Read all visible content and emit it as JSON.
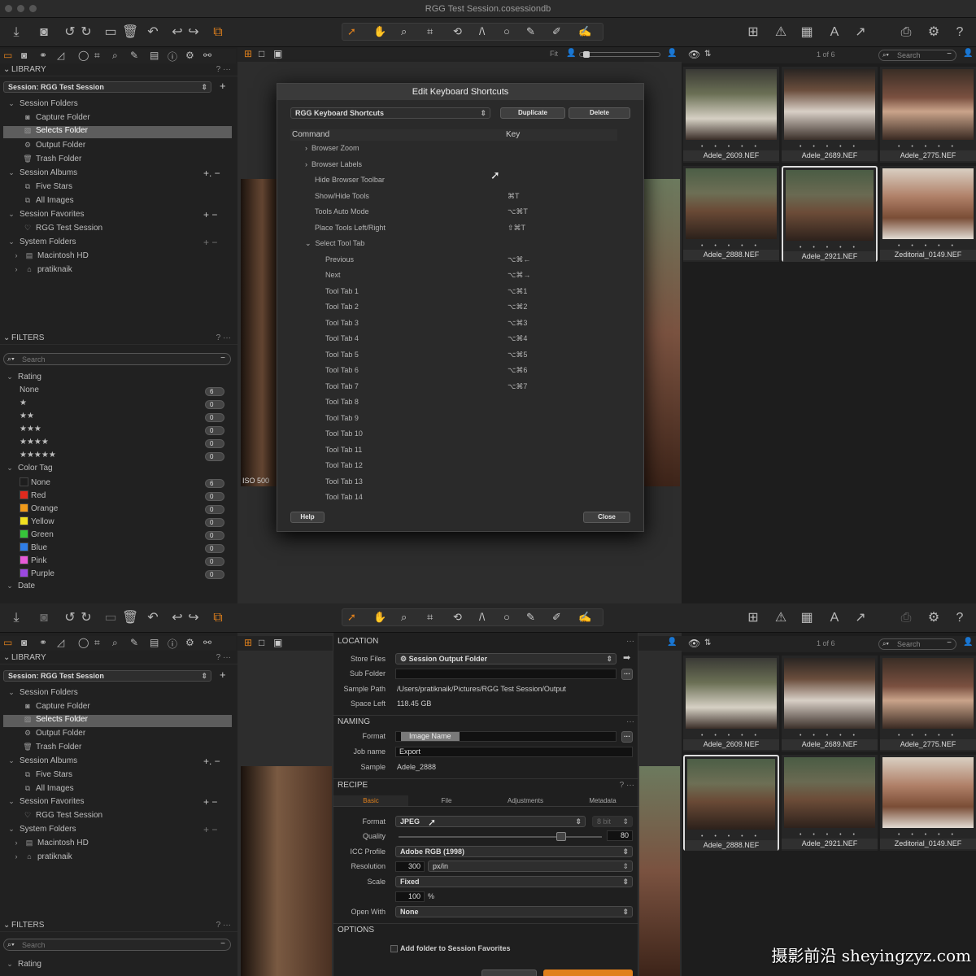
{
  "window": {
    "title": "RGG Test Session.cosessiondb"
  },
  "library": {
    "header": "LIBRARY",
    "session": "Session: RGG Test Session",
    "session_folders": "Session Folders",
    "items": [
      "Capture Folder",
      "Selects Folder",
      "Output Folder",
      "Trash Folder"
    ],
    "session_albums": "Session Albums",
    "albums": [
      "Five Stars",
      "All Images"
    ],
    "session_favorites": "Session Favorites",
    "favorites": [
      "RGG Test Session"
    ],
    "system_folders": "System Folders",
    "system": [
      "Macintosh HD",
      "pratiknaik"
    ]
  },
  "filters": {
    "header": "FILTERS",
    "search_placeholder": "Search",
    "rating": "Rating",
    "ratings": [
      {
        "label": "None",
        "count": "6"
      },
      {
        "label": "★",
        "count": "0"
      },
      {
        "label": "★★",
        "count": "0"
      },
      {
        "label": "★★★",
        "count": "0"
      },
      {
        "label": "★★★★",
        "count": "0"
      },
      {
        "label": "★★★★★",
        "count": "0"
      }
    ],
    "color_tag": "Color Tag",
    "colors": [
      {
        "label": "None",
        "count": "6",
        "hex": "#1e1e1e"
      },
      {
        "label": "Red",
        "count": "0",
        "hex": "#e02a1e"
      },
      {
        "label": "Orange",
        "count": "0",
        "hex": "#f09a1a"
      },
      {
        "label": "Yellow",
        "count": "0",
        "hex": "#f0e020"
      },
      {
        "label": "Green",
        "count": "0",
        "hex": "#36c43a"
      },
      {
        "label": "Blue",
        "count": "0",
        "hex": "#2f7de6"
      },
      {
        "label": "Pink",
        "count": "0",
        "hex": "#e65ad8"
      },
      {
        "label": "Purple",
        "count": "0",
        "hex": "#9b48e0"
      }
    ],
    "date": "Date"
  },
  "viewer": {
    "fit": "Fit",
    "iso": "ISO 500"
  },
  "browser": {
    "counter": "1 of 6",
    "search_placeholder": "Search",
    "thumbs": [
      "Adele_2609.NEF",
      "Adele_2689.NEF",
      "Adele_2775.NEF",
      "Adele_2888.NEF",
      "Adele_2921.NEF",
      "Zeditorial_0149.NEF"
    ],
    "stars": "• • • • •"
  },
  "dialog": {
    "title": "Edit Keyboard Shortcuts",
    "set": "RGG Keyboard Shortcuts",
    "duplicate": "Duplicate",
    "delete": "Delete",
    "col_command": "Command",
    "col_key": "Key",
    "rows": [
      {
        "label": "Browser Zoom",
        "key": "",
        "lvl": 1,
        "arrow": "›"
      },
      {
        "label": "Browser Labels",
        "key": "",
        "lvl": 1,
        "arrow": "›"
      },
      {
        "label": "Hide Browser Toolbar",
        "key": "",
        "lvl": 1,
        "arrow": ""
      },
      {
        "label": "Show/Hide Tools",
        "key": "⌘T",
        "lvl": 1,
        "arrow": ""
      },
      {
        "label": "Tools Auto Mode",
        "key": "⌥⌘T",
        "lvl": 1,
        "arrow": ""
      },
      {
        "label": "Place Tools Left/Right",
        "key": "⇧⌘T",
        "lvl": 1,
        "arrow": ""
      },
      {
        "label": "Select Tool Tab",
        "key": "",
        "lvl": 1,
        "arrow": "⌄"
      },
      {
        "label": "Previous",
        "key": "⌥⌘←",
        "lvl": 2,
        "arrow": ""
      },
      {
        "label": "Next",
        "key": "⌥⌘→",
        "lvl": 2,
        "arrow": ""
      },
      {
        "label": "Tool Tab 1",
        "key": "⌥⌘1",
        "lvl": 2,
        "arrow": ""
      },
      {
        "label": "Tool Tab 2",
        "key": "⌥⌘2",
        "lvl": 2,
        "arrow": ""
      },
      {
        "label": "Tool Tab 3",
        "key": "⌥⌘3",
        "lvl": 2,
        "arrow": ""
      },
      {
        "label": "Tool Tab 4",
        "key": "⌥⌘4",
        "lvl": 2,
        "arrow": ""
      },
      {
        "label": "Tool Tab 5",
        "key": "⌥⌘5",
        "lvl": 2,
        "arrow": ""
      },
      {
        "label": "Tool Tab 6",
        "key": "⌥⌘6",
        "lvl": 2,
        "arrow": ""
      },
      {
        "label": "Tool Tab 7",
        "key": "⌥⌘7",
        "lvl": 2,
        "arrow": ""
      },
      {
        "label": "Tool Tab 8",
        "key": "",
        "lvl": 2,
        "arrow": ""
      },
      {
        "label": "Tool Tab 9",
        "key": "",
        "lvl": 2,
        "arrow": ""
      },
      {
        "label": "Tool Tab 10",
        "key": "",
        "lvl": 2,
        "arrow": ""
      },
      {
        "label": "Tool Tab 11",
        "key": "",
        "lvl": 2,
        "arrow": ""
      },
      {
        "label": "Tool Tab 12",
        "key": "",
        "lvl": 2,
        "arrow": ""
      },
      {
        "label": "Tool Tab 13",
        "key": "",
        "lvl": 2,
        "arrow": ""
      },
      {
        "label": "Tool Tab 14",
        "key": "",
        "lvl": 2,
        "arrow": ""
      }
    ],
    "help": "Help",
    "close": "Close"
  },
  "output": {
    "location": {
      "header": "LOCATION",
      "store_label": "Store Files",
      "store": "Session Output Folder",
      "sub_label": "Sub Folder",
      "sample_label": "Sample Path",
      "sample_path": "/Users/pratiknaik/Pictures/RGG Test Session/Output",
      "space_label": "Space Left",
      "space": "118.45 GB"
    },
    "naming": {
      "header": "NAMING",
      "format_label": "Format",
      "format_token": "Image Name",
      "job_label": "Job name",
      "job": "Export",
      "sample_label": "Sample",
      "sample": "Adele_2888"
    },
    "recipe": {
      "header": "RECIPE",
      "tabs": [
        "Basic",
        "File",
        "Adjustments",
        "Metadata"
      ],
      "format_label": "Format",
      "format": "JPEG",
      "bit": "8 bit",
      "quality_label": "Quality",
      "quality": "80",
      "icc_label": "ICC Profile",
      "icc": "Adobe RGB (1998)",
      "res_label": "Resolution",
      "res": "300",
      "res_unit": "px/in",
      "scale_label": "Scale",
      "scale": "Fixed",
      "scale_val": "100",
      "scale_unit": "%",
      "open_label": "Open With",
      "open": "None"
    },
    "options": {
      "header": "OPTIONS",
      "add_fav": "Add folder to Session Favorites"
    }
  },
  "watermark": "摄影前沿 sheyingzyz.com"
}
